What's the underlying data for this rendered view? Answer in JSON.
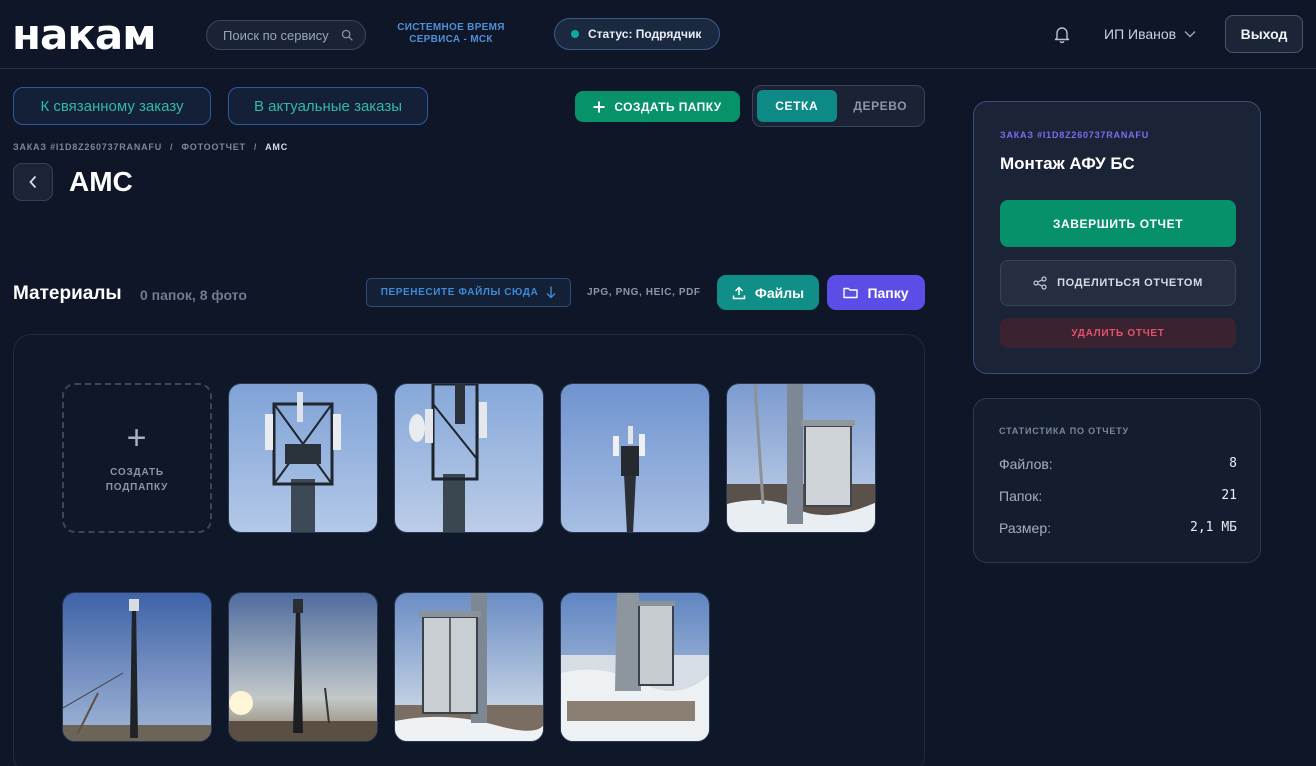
{
  "header": {
    "logo": "накам",
    "search_placeholder": "Поиск по сервису",
    "system_time_line1": "СИСТЕМНОЕ ВРЕМЯ",
    "system_time_line2": "СЕРВИСА - МСК",
    "status": "Статус: Подрядчик",
    "user": "ИП Иванов",
    "logout": "Выход"
  },
  "actions": {
    "linked_order": "К связанному заказу",
    "current_orders": "В актуальные заказы",
    "create_folder": "СОЗДАТЬ ПАПКУ",
    "view_grid": "СЕТКА",
    "view_tree": "ДЕРЕВО"
  },
  "breadcrumb": {
    "order": "ЗАКАЗ #I1D8Z260737RANAFU",
    "sep1": "/",
    "report": "ФОТООТЧЕТ",
    "sep2": "/",
    "current": "АМС"
  },
  "page": {
    "title": "АМС"
  },
  "materials": {
    "title": "Материалы",
    "count": "0 папок, 8 фото",
    "drop_hint": "ПЕРЕНЕСИТЕ ФАЙЛЫ СЮДА",
    "formats": "JPG, PNG, HEIC, PDF",
    "files_button": "Файлы",
    "folder_button": "Папку",
    "new_subfolder_line1": "СОЗДАТЬ",
    "new_subfolder_line2": "ПОДПАПКУ",
    "photos": [
      "tower-top-antennas",
      "tower-antennas-closeup",
      "tower-distant",
      "equipment-cabinet-snow",
      "tower-field-evening",
      "tower-sunset",
      "cabinet-under-tower",
      "cabinet-base-snow"
    ]
  },
  "report_card": {
    "order": "ЗАКАЗ #I1D8Z260737RANAFU",
    "name": "Монтаж АФУ БС",
    "finish": "ЗАВЕРШИТЬ ОТЧЕТ",
    "share": "ПОДЕЛИТЬСЯ ОТЧЕТОМ",
    "delete": "УДАЛИТЬ ОТЧЕТ"
  },
  "stats": {
    "title": "СТАТИСТИКА ПО ОТЧЕТУ",
    "files_label": "Файлов:",
    "files_value": "8",
    "folders_label": "Папок:",
    "folders_value": "21",
    "size_label": "Размер:",
    "size_value": "2,1 МБ"
  },
  "colors": {
    "background": "#0e1628",
    "accent_green": "#07916b",
    "accent_teal": "#0f8f88",
    "accent_purple": "#5a4ee6",
    "danger": "#e4526a"
  }
}
